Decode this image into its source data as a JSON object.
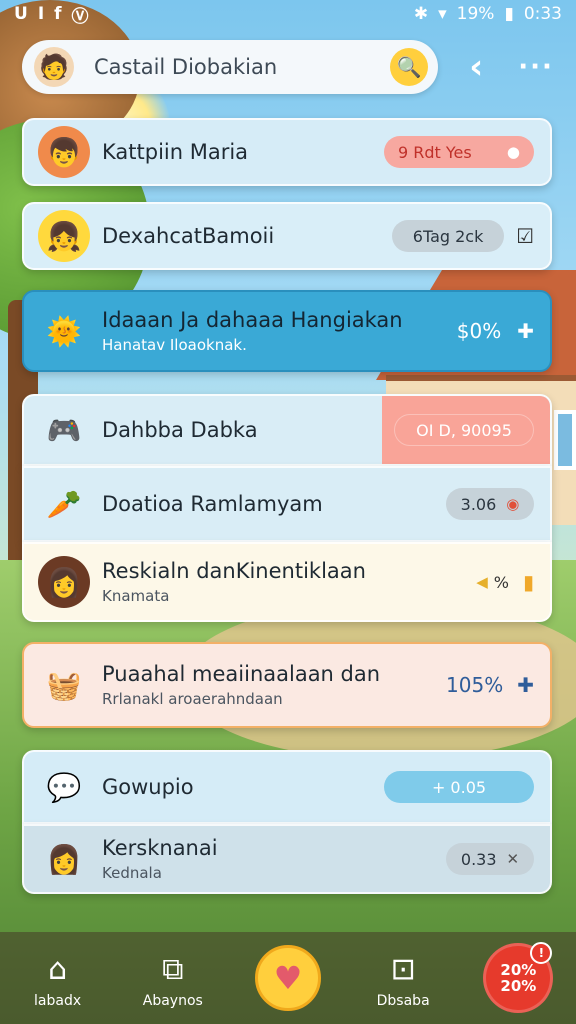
{
  "status_bar": {
    "left_icons": [
      "bracket-icon",
      "dot-icon",
      "flag-icon",
      "brand-icon"
    ],
    "left_glyphs": [
      "U",
      "I",
      "f",
      "Ⓥ"
    ],
    "bluetooth": "✱",
    "wifi": "▾",
    "battery_pct": "19%",
    "battery_glyph": "▮",
    "time": "0:33"
  },
  "header": {
    "title": "Castail Diobakian",
    "avatar_glyph": "🧑",
    "badge_glyph": "🔍",
    "back_glyph": "‹",
    "more_glyph": "···"
  },
  "cards": [
    {
      "title": "Kattpiin Maria",
      "pill": "9 Rdt Yes",
      "pill_icon": "●",
      "icon": "👦",
      "trail": ""
    },
    {
      "title": "DexahcatBamoii",
      "pill": "6Tag 2ck",
      "pill_icon": "",
      "icon": "👧",
      "trail": "☑"
    },
    {
      "title": "Idaaan Ja dahaaa Hangiakan",
      "sub": "Hanatav Iloaoknak.",
      "pill": "$0%",
      "pill_icon": "",
      "icon": "🌞",
      "trail": "✚"
    },
    {
      "title": "Dahbba Dabka",
      "pill": "OI D, 90095",
      "pill_icon": "",
      "icon": "🎮",
      "trail": ""
    },
    {
      "title": "Doatioa Ramlamyam",
      "pill": "3.06",
      "pill_icon": "◉",
      "icon": "🥕",
      "trail": ""
    },
    {
      "title": "Reskialn danKinentiklaan",
      "sub": "Knamata",
      "pill": "%",
      "pill_icon": "◀",
      "icon": "👩",
      "trail": "▮"
    },
    {
      "title": "Puaahal meaiinaalaan dan",
      "sub": "Rrlanakl aroaerahndaan",
      "pill": "105%",
      "pill_icon": "",
      "icon": "🧺",
      "trail": "✚"
    },
    {
      "title": "Gowupio",
      "pill": "+ 0.05",
      "pill_icon": "",
      "icon": "💬",
      "trail": ""
    },
    {
      "title": "Kersknanai",
      "sub": "Kednala",
      "pill": "0.33",
      "pill_icon": "✕",
      "icon": "👩",
      "trail": ""
    }
  ],
  "nav": [
    {
      "label": "labadx",
      "icon": "⌂"
    },
    {
      "label": "Abaynos",
      "icon": "⧉"
    },
    {
      "label": "",
      "icon": "♥"
    },
    {
      "label": "Dbsaba",
      "icon": "⊡"
    },
    {
      "label": "",
      "icon": "20%\n20%",
      "badge": "!"
    }
  ],
  "colors": {
    "accent": "#3aa9d6",
    "pill_red": "#f7a8a0",
    "pill_gray": "#c6d2d9",
    "pill_blue": "#7fcbea",
    "nav_center": "#ffcf3d",
    "nav_red": "#e63a2c"
  }
}
